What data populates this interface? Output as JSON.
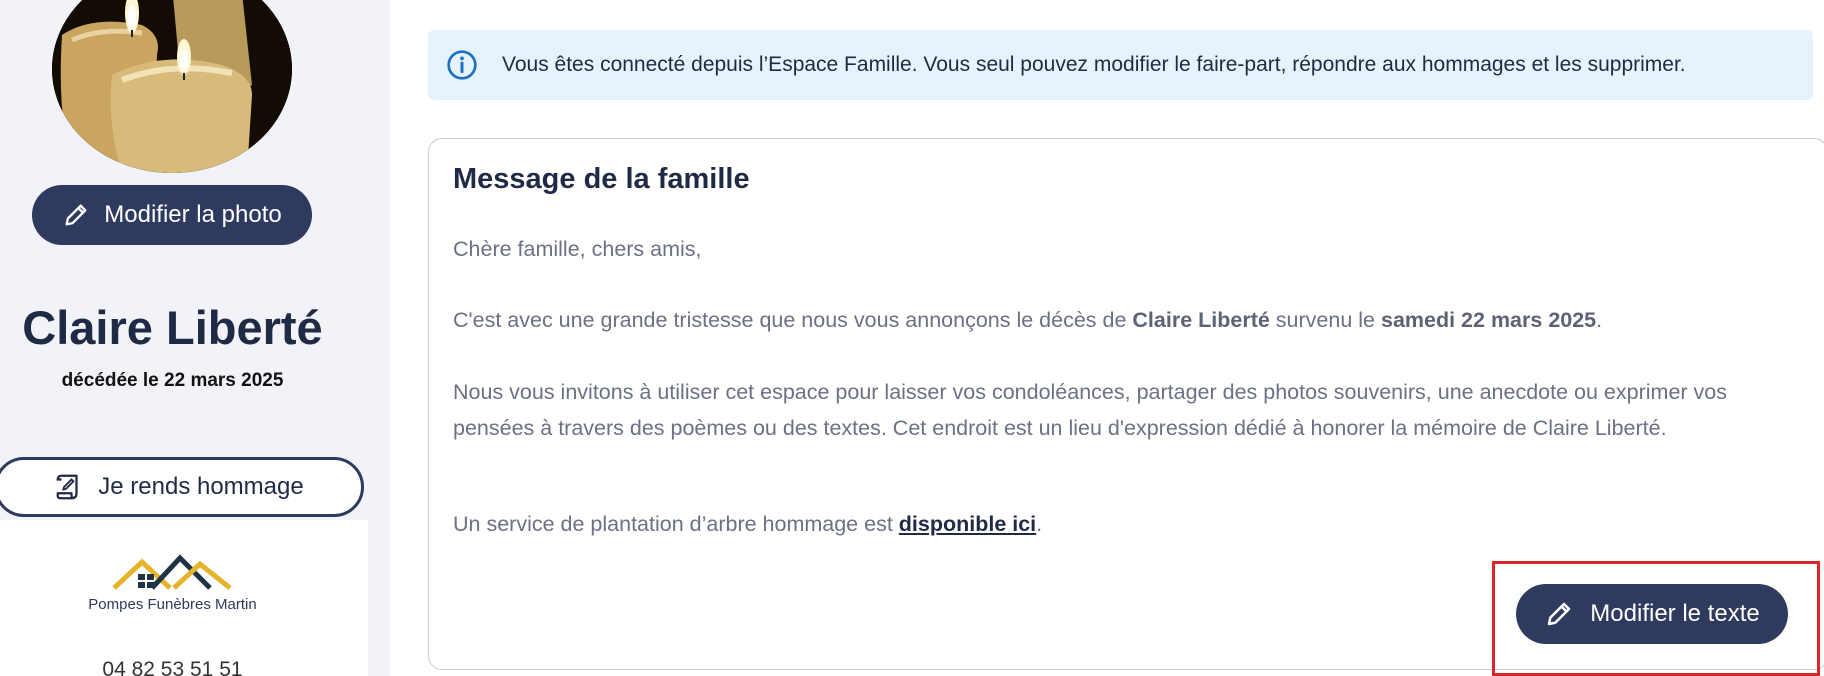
{
  "sidebar": {
    "edit_photo_label": "Modifier la photo",
    "name": "Claire Liberté",
    "death_date": "décédée le 22 mars 2025",
    "tribute_label": "Je rends hommage",
    "funeral_home": {
      "name": "Pompes Funèbres Martin",
      "phone": "04 82 53 51 51"
    }
  },
  "info_banner": {
    "text": "Vous êtes connecté depuis l’Espace Famille. Vous seul pouvez modifier le faire-part, répondre aux hommages et les supprimer."
  },
  "message": {
    "title": "Message de la famille",
    "greeting": "Chère famille, chers amis,",
    "p1_before": "C'est avec une grande tristesse que nous vous annonçons le décès de ",
    "p1_name": "Claire Liberté",
    "p1_middle": " survenu le ",
    "p1_date": "samedi 22 mars 2025",
    "p1_end": ".",
    "p2": "Nous vous invitons à utiliser cet espace pour laisser vos condoléances, partager des photos souvenirs, une anecdote ou exprimer vos pensées à travers des poèmes ou des textes. Cet endroit est un lieu d'expression dédié à honorer la mémoire de Claire Liberté.",
    "p3_before": "Un service de plantation d’arbre hommage est ",
    "p3_link": "disponible ici",
    "p3_end": ".",
    "edit_text_label": "Modifier le texte"
  },
  "colors": {
    "primary": "#2f3a5f",
    "banner_bg": "#e6f3fc",
    "info_blue": "#1b6fc4",
    "highlight_red": "#d8262c",
    "logo_gold": "#e6b42a"
  }
}
